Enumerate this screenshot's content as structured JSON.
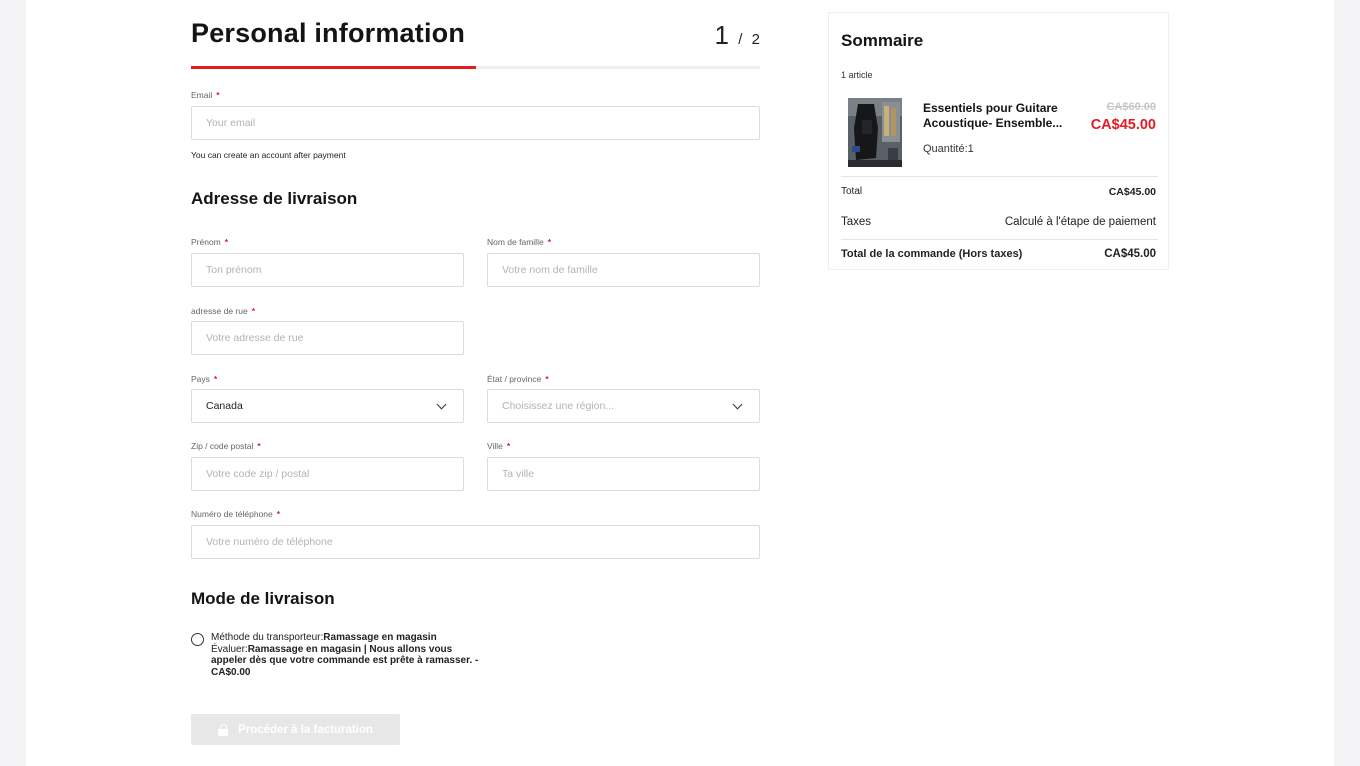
{
  "form": {
    "title": "Personal information",
    "step_current": "1",
    "step_sep": "/",
    "step_total": "2",
    "progress": 0.5,
    "required_mark": "*",
    "email_label": "Email",
    "email_placeholder": "Your email",
    "email_help": "You can create an account after payment"
  },
  "address": {
    "title": "Adresse de livraison",
    "first_name_label": "Prénom",
    "first_name_placeholder": "Ton prénom",
    "last_name_label": "Nom de famille",
    "last_name_placeholder": "Votre nom de famille",
    "street_label": "adresse de rue",
    "street_placeholder": "Votre adresse de rue",
    "country_label": "Pays",
    "country_value": "Canada",
    "region_label": "État / province",
    "region_placeholder": "Choisissez une région...",
    "zip_label": "Zip / code postal",
    "zip_placeholder": "Votre code zip / postal",
    "city_label": "Ville",
    "city_placeholder": "Ta ville",
    "phone_label": "Numéro de téléphone",
    "phone_placeholder": "Votre numéro de téléphone"
  },
  "shipping": {
    "title": "Mode de livraison",
    "carrier_prefix": "Méthode du transporteur:",
    "carrier_name": "Ramassage en magasin",
    "rate_prefix": "Évaluer:",
    "rate_text": "Ramassage en magasin | Nous allons vous appeler dès que votre commande est prête à ramasser. - CA$0.00",
    "button_label": "Procéder à la facturation"
  },
  "summary": {
    "title": "Sommaire",
    "count": "1 article",
    "product_name_line1": "Essentiels pour Guitare",
    "product_name_line2": "Acoustique- Ensemble...",
    "old_price": "CA$60.00",
    "new_price": "CA$45.00",
    "quantity": "Quantité:1",
    "total_label": "Total",
    "total_value": "CA$45.00",
    "taxes_label": "Taxes",
    "taxes_value": "Calculé à l'étape de paiement",
    "order_total_label": "Total de la commande (Hors taxes)",
    "order_total_value": "CA$45.00"
  },
  "colors": {
    "accent": "#e31b23",
    "button_disabled": "#e7e7e7"
  },
  "icons": {
    "button": "lock-icon",
    "select": "chevron-down-icon"
  }
}
